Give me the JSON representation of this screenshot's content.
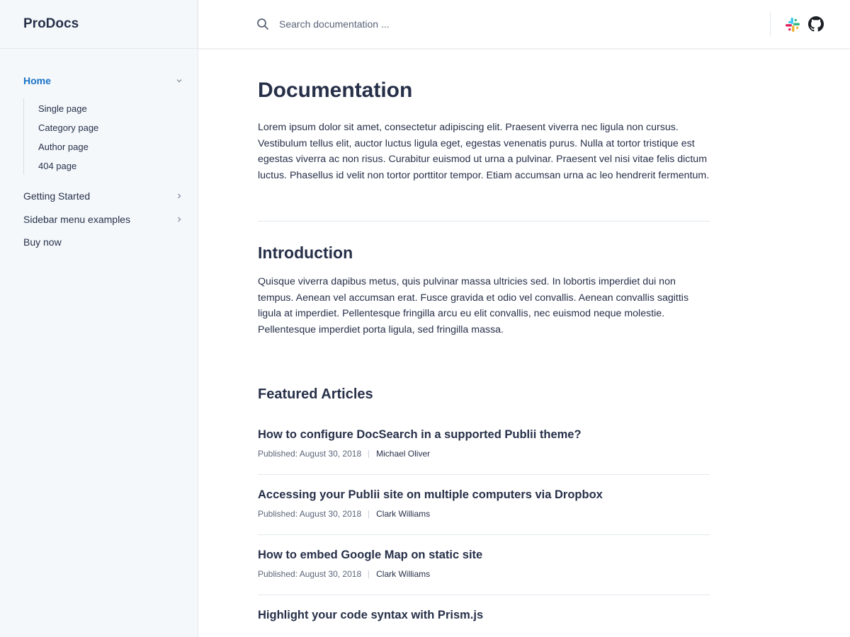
{
  "brand": "ProDocs",
  "search": {
    "placeholder": "Search documentation ..."
  },
  "sidebar": {
    "items": [
      {
        "label": "Home"
      },
      {
        "label": "Getting Started"
      },
      {
        "label": "Sidebar menu examples"
      },
      {
        "label": "Buy now"
      }
    ],
    "subitems": [
      {
        "label": "Single page"
      },
      {
        "label": "Category page"
      },
      {
        "label": "Author page"
      },
      {
        "label": "404 page"
      }
    ]
  },
  "main": {
    "title": "Documentation",
    "intro_paragraph": "Lorem ipsum dolor sit amet, consectetur adipiscing elit. Praesent viverra nec ligula non cursus. Vestibulum tellus elit, auctor luctus ligula eget, egestas venenatis purus. Nulla at tortor tristique est egestas viverra ac non risus. Curabitur euismod ut urna a pulvinar. Praesent vel nisi vitae felis dictum luctus. Phasellus id velit non tortor porttitor tempor. Etiam accumsan urna ac leo hendrerit fermentum.",
    "section_title": "Introduction",
    "section_paragraph": "Quisque viverra dapibus metus, quis pulvinar massa ultricies sed. In lobortis imperdiet dui non tempus. Aenean vel accumsan erat. Fusce gravida et odio vel convallis. Aenean convallis sagittis ligula at imperdiet. Pellentesque fringilla arcu eu elit convallis, nec euismod neque molestie. Pellentesque imperdiet porta ligula, sed fringilla massa.",
    "featured_title": "Featured Articles",
    "articles": [
      {
        "title": "How to configure DocSearch in a supported Publii theme?",
        "published": "Published: August 30, 2018",
        "author": "Michael Oliver"
      },
      {
        "title": "Accessing your Publii site on multiple computers via Dropbox",
        "published": "Published: August 30, 2018",
        "author": "Clark Williams"
      },
      {
        "title": "How to embed Google Map on static site",
        "published": "Published: August 30, 2018",
        "author": "Clark Williams"
      },
      {
        "title": "Highlight your code syntax with Prism.js"
      }
    ]
  },
  "colors": {
    "accent": "#1a73c7",
    "text": "#273049",
    "sidebar_bg": "#f4f8fb"
  }
}
